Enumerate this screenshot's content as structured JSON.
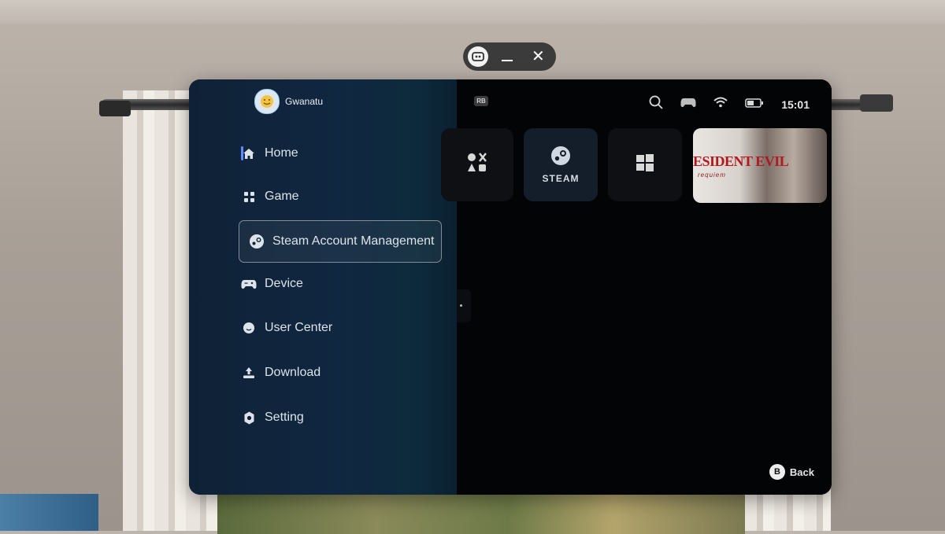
{
  "user": {
    "name": "Gwanatu"
  },
  "nav": {
    "items": [
      {
        "label": "Home",
        "icon": "home-icon"
      },
      {
        "label": "Game",
        "icon": "grid-icon"
      },
      {
        "label": "Steam Account Management",
        "icon": "steam-icon"
      },
      {
        "label": "Device",
        "icon": "controller-icon"
      },
      {
        "label": "User Center",
        "icon": "smiley-icon"
      },
      {
        "label": "Download",
        "icon": "download-icon"
      },
      {
        "label": "Setting",
        "icon": "gear-icon"
      }
    ],
    "active_index": 0,
    "selected_index": 2
  },
  "topbar": {
    "rb": "RB",
    "time": "15:01"
  },
  "tiles": {
    "steam_label": "STEAM",
    "game_title": "ESIDENT EVIL",
    "game_subtitle": "requiem"
  },
  "footer": {
    "b_key": "B",
    "back_label": "Back"
  },
  "colors": {
    "accent": "#5a8dff",
    "panel_bg": "#040506",
    "sidebar_bg": "#102741"
  }
}
